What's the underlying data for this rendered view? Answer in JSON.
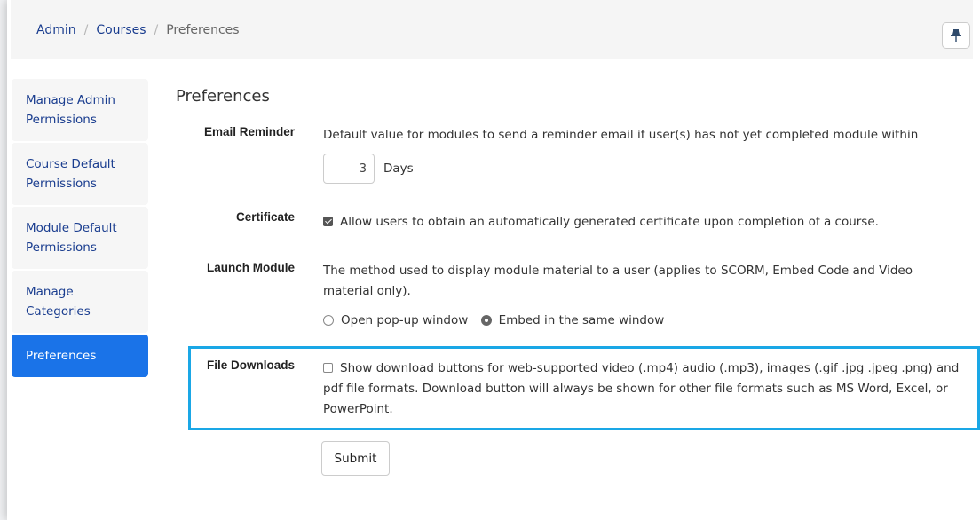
{
  "breadcrumb": {
    "items": [
      "Admin",
      "Courses"
    ],
    "current": "Preferences",
    "separator": "/"
  },
  "header": {
    "pin_icon": "pin-icon"
  },
  "sidebar": {
    "items": [
      {
        "label": "Manage Admin Permissions",
        "active": false
      },
      {
        "label": "Course Default Permissions",
        "active": false
      },
      {
        "label": "Module Default Permissions",
        "active": false
      },
      {
        "label": "Manage Categories",
        "active": false
      },
      {
        "label": "Preferences",
        "active": true
      }
    ]
  },
  "main": {
    "title": "Preferences",
    "email_reminder": {
      "label": "Email Reminder",
      "description": "Default value for modules to send a reminder email if user(s) has not yet completed module within",
      "days_value": "3",
      "days_unit": "Days"
    },
    "certificate": {
      "label": "Certificate",
      "checked": true,
      "text": "Allow users to obtain an automatically generated certificate upon completion of a course."
    },
    "launch_module": {
      "label": "Launch Module",
      "description": "The method used to display module material to a user (applies to SCORM, Embed Code and Video material only).",
      "options": [
        "Open pop-up window",
        "Embed in the same window"
      ],
      "selected": "Embed in the same window"
    },
    "file_downloads": {
      "label": "File Downloads",
      "checked": false,
      "text": "Show download buttons for web-supported video (.mp4) audio (.mp3), images (.gif .jpg .jpeg .png) and pdf file formats. Download button will always be shown for other file formats such as MS Word, Excel, or PowerPoint."
    },
    "submit_label": "Submit"
  },
  "colors": {
    "accent": "#1a73e8",
    "link": "#1a3d8f",
    "highlight": "#1aa7e6"
  }
}
